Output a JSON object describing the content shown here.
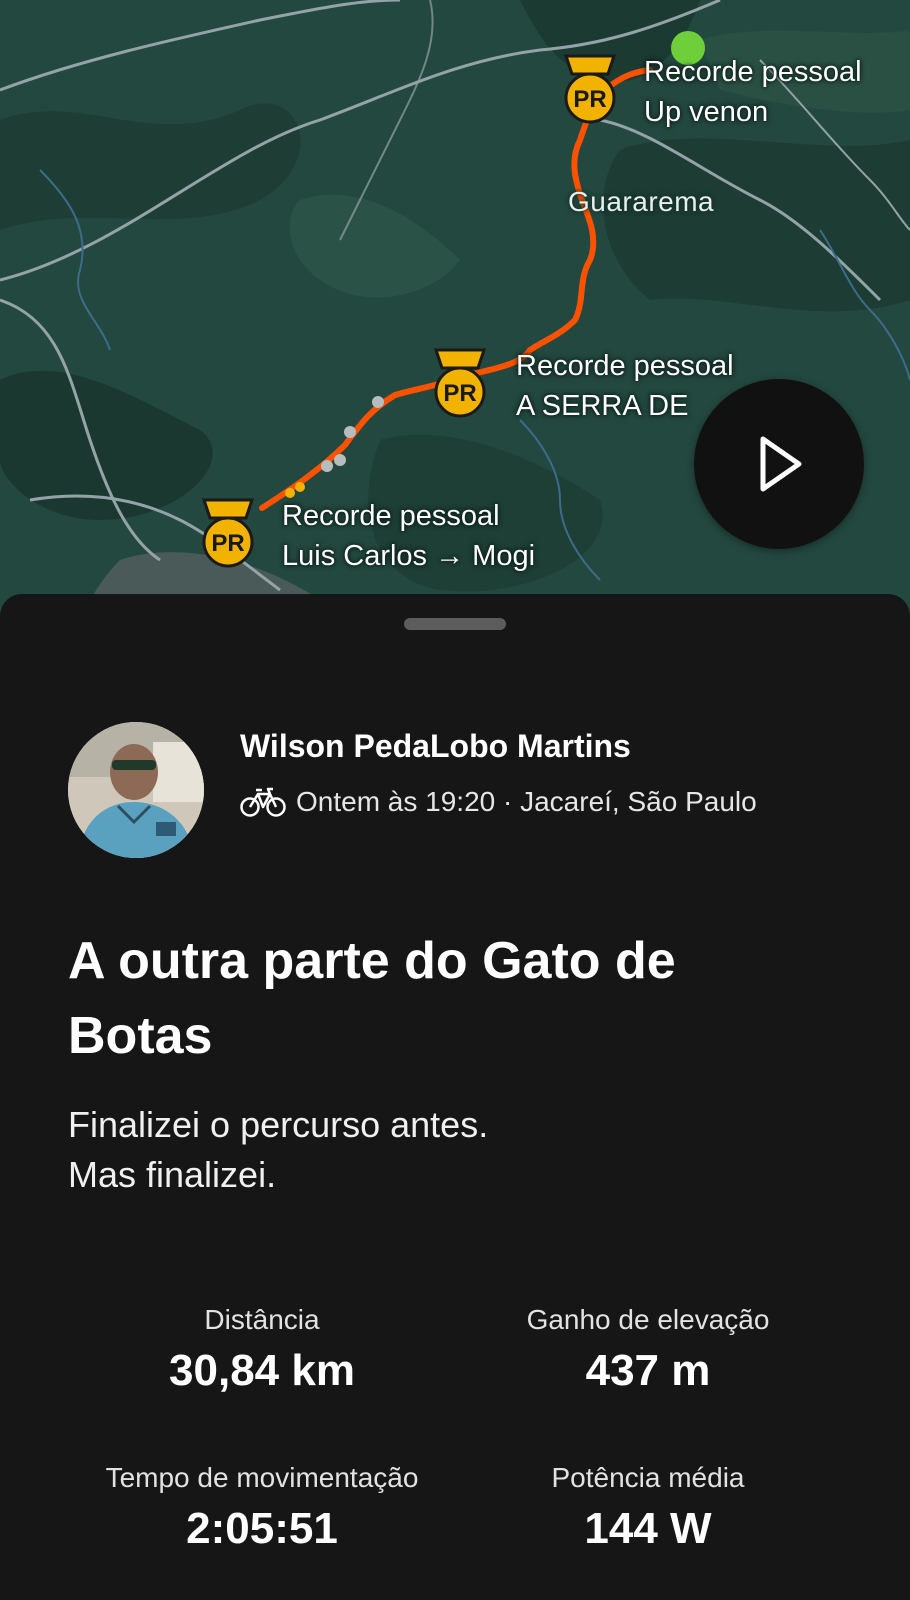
{
  "map": {
    "pr_markers": [
      {
        "badge": "PR",
        "line1": "Recorde pessoal",
        "line2": "Up venon"
      },
      {
        "badge": "PR",
        "line1": "Recorde pessoal",
        "line2": "A SERRA DE"
      },
      {
        "badge": "PR",
        "line1": "Recorde pessoal",
        "line2": "Luis Carlos → Mogi"
      }
    ],
    "place_label": "Guararema",
    "route_color": "#fc5200",
    "play_icon": "play-icon"
  },
  "activity": {
    "athlete_name": "Wilson PedaLobo Martins",
    "sport_icon": "bike-icon",
    "meta": "Ontem às 19:20 · Jacareí, São Paulo",
    "title": "A outra parte do Gato de Botas",
    "description": [
      "Finalizei o percurso antes.",
      "Mas finalizei."
    ],
    "stats": [
      {
        "label": "Distância",
        "value": "30,84 km"
      },
      {
        "label": "Ganho de elevação",
        "value": "437 m"
      },
      {
        "label": "Tempo de movimentação",
        "value": "2:05:51"
      },
      {
        "label": "Potência média",
        "value": "144 W"
      }
    ]
  }
}
